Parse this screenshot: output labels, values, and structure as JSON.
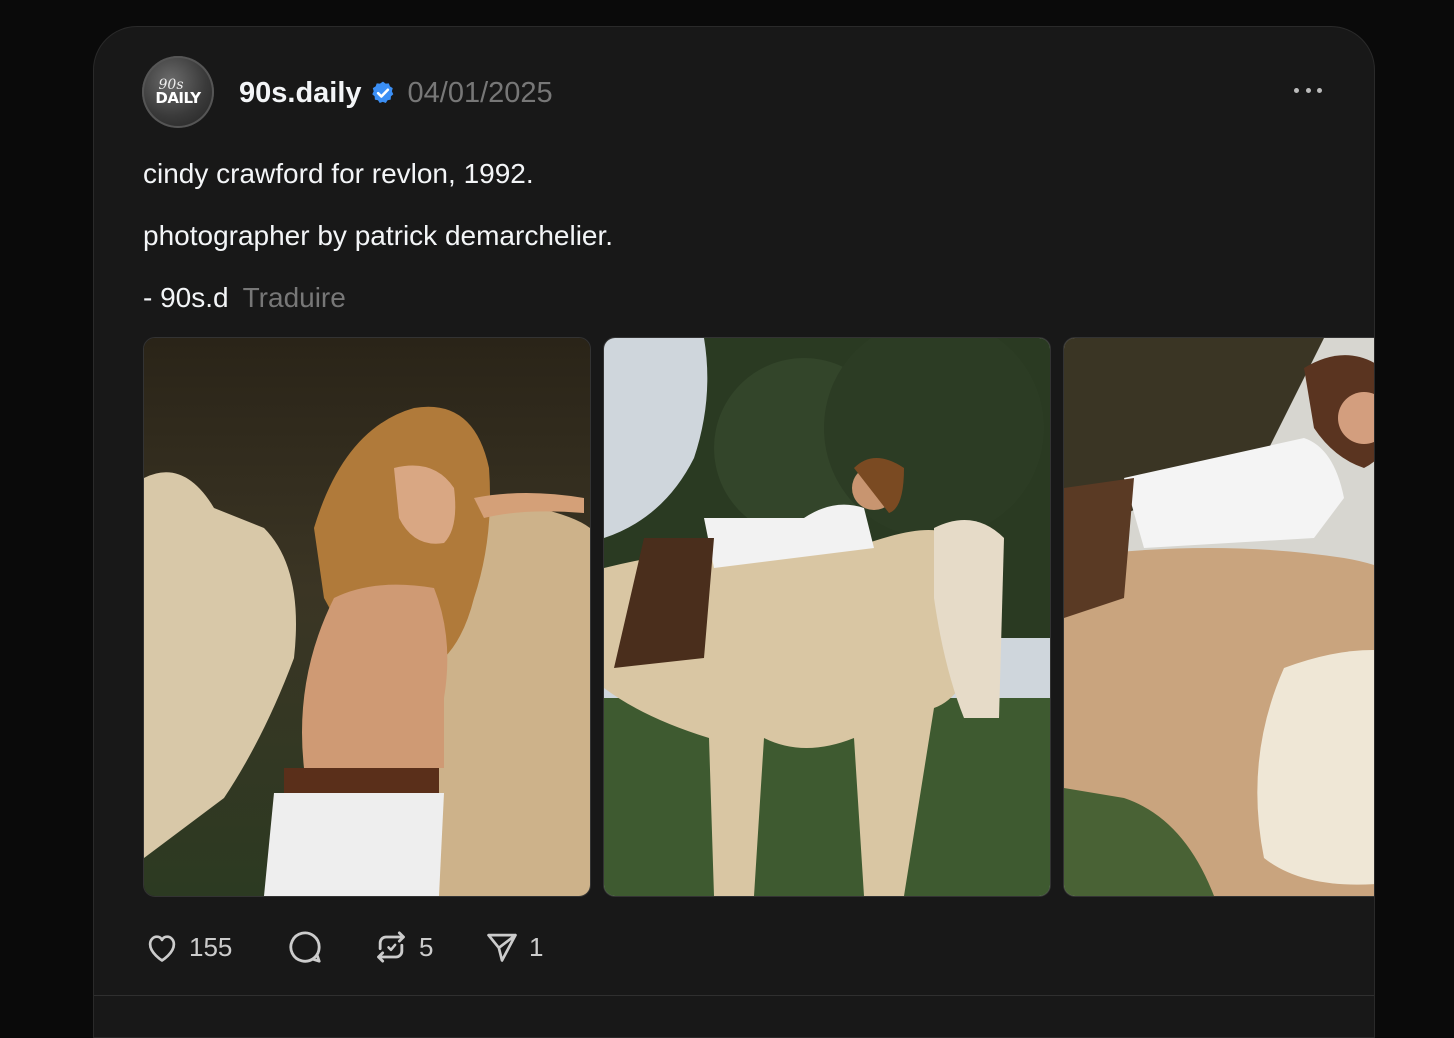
{
  "post": {
    "avatar_text_line1": "90s",
    "avatar_text_line2": "DAILY",
    "username": "90s.daily",
    "verified": true,
    "date": "04/01/2025",
    "body_lines": [
      "cindy crawford for revlon, 1992.",
      "photographer by patrick demarchelier.",
      "- 90s.d"
    ],
    "translate_label": "Traduire",
    "images": [
      {
        "alt_icon": "photo-woman-horse-1"
      },
      {
        "alt_icon": "photo-woman-on-horse-2"
      },
      {
        "alt_icon": "photo-woman-on-horse-3"
      }
    ],
    "actions": {
      "likes": "155",
      "replies": "",
      "reposts": "5",
      "shares": "1"
    }
  },
  "colors": {
    "background": "#0a0a0a",
    "card": "#181818",
    "text_primary": "#f3f5f7",
    "text_secondary": "#777777",
    "verified": "#3b8ff5"
  }
}
